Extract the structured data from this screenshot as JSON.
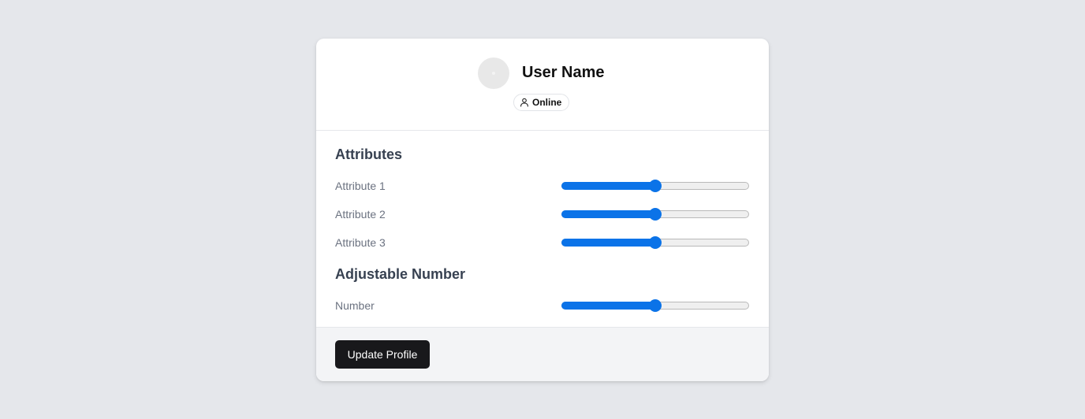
{
  "user": {
    "name": "User Name",
    "status": "Online",
    "avatar_icon": "avatar-placeholder",
    "status_icon": "user-icon"
  },
  "attributes": {
    "title": "Attributes",
    "items": [
      {
        "label": "Attribute 1",
        "value": 50,
        "min": 0,
        "max": 100
      },
      {
        "label": "Attribute 2",
        "value": 50,
        "min": 0,
        "max": 100
      },
      {
        "label": "Attribute 3",
        "value": 50,
        "min": 0,
        "max": 100
      }
    ]
  },
  "adjustable": {
    "title": "Adjustable Number",
    "label": "Number",
    "value": 50,
    "min": 0,
    "max": 100
  },
  "footer": {
    "update_label": "Update Profile"
  },
  "colors": {
    "accent": "#0b73e8",
    "button": "#18181b",
    "background": "#e5e7eb"
  }
}
